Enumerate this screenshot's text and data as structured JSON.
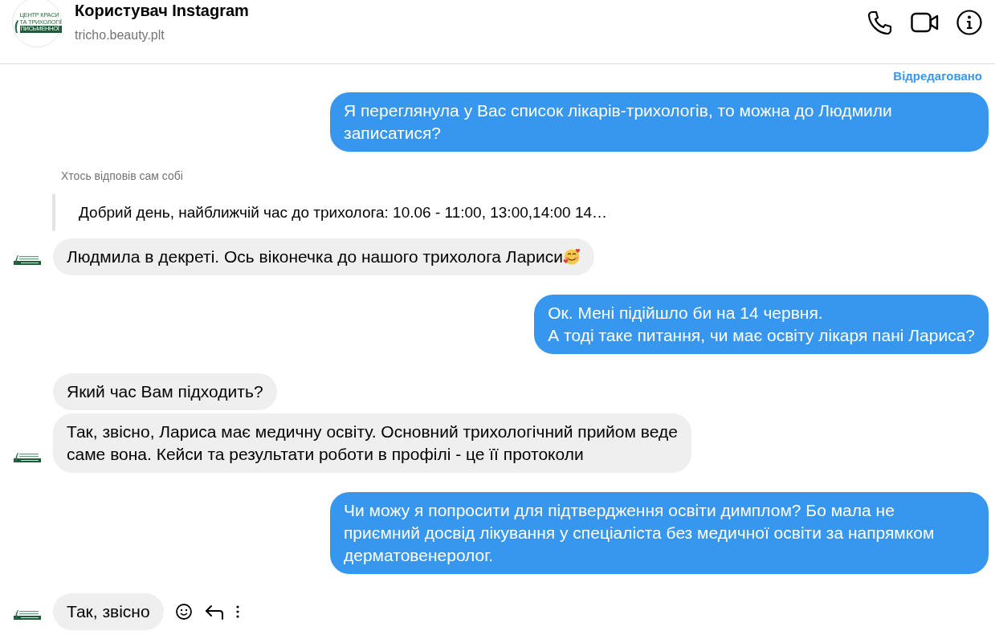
{
  "header": {
    "logo_lines": [
      "ЦЕНТР КРАСИ",
      "ТА ТРИХОЛОГІЇ",
      "ПИСЬМЕННОЇ"
    ],
    "title": "Користувач Instagram",
    "subtitle": "tricho.beauty.plt"
  },
  "messages": [
    {
      "kind": "outgoing",
      "edited_label": "Відредаговано",
      "text": "Я переглянула у Вас список лікарів-трихологів, то можна до Людмили записатися?"
    },
    {
      "kind": "reply",
      "label": "Хтось відповів сам собі",
      "text": "Добрий день, найближчій час до трихолога: 10.06 - 11:00, 13:00,14:00 14…"
    },
    {
      "kind": "incoming",
      "avatar": true,
      "emoji": true,
      "text": "Людмила в декреті. Ось віконечка до нашого трихолога Лариси"
    },
    {
      "kind": "outgoing",
      "text": "Ок. Мені підійшло би на 14 червня.\nА тоді таке питання, чи має освіту лікаря пані Лариса?"
    },
    {
      "kind": "incoming",
      "avatar": false,
      "text": "Який час Вам підходить?"
    },
    {
      "kind": "incoming",
      "avatar": true,
      "text": "Так, звісно, Лариса має медичну освіту. Основний трихологічний прийом веде\nсаме вона. Кейси та результати роботи в профілі - це її протоколи"
    },
    {
      "kind": "outgoing",
      "text": "Чи можу я попросити для підтвердження освіти димплом? Бо мала не приємний досвід лікування у спеціаліста без медичної освіти за напрямком дерматовенеролог."
    },
    {
      "kind": "incoming",
      "avatar": true,
      "hover_actions": true,
      "text": "Так, звісно"
    }
  ]
}
